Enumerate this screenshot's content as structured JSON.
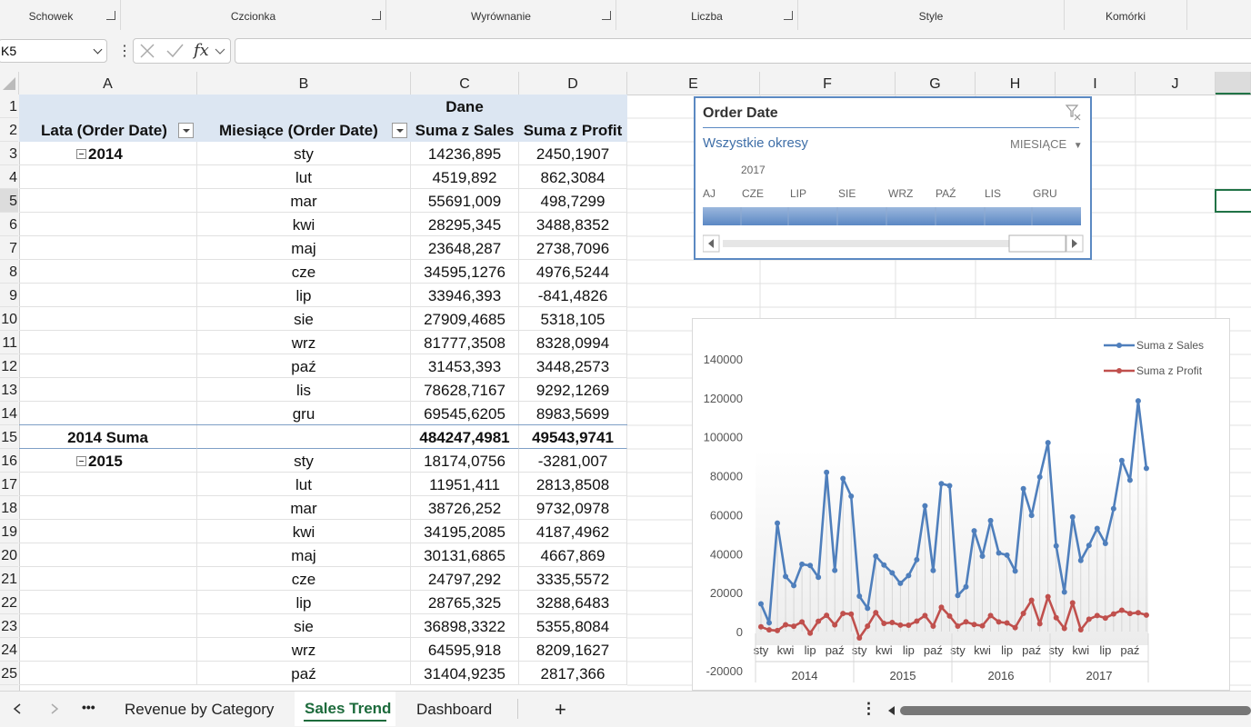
{
  "ribbon": {
    "groups": [
      {
        "label": "Schowek",
        "launcher": true
      },
      {
        "label": "Czcionka",
        "launcher": true
      },
      {
        "label": "Wyrównanie",
        "launcher": true
      },
      {
        "label": "Liczba",
        "launcher": true
      },
      {
        "label": "Style",
        "launcher": false
      },
      {
        "label": "Komórki",
        "launcher": false
      }
    ]
  },
  "formula_bar": {
    "name_box": "K5",
    "fx_label": "fx",
    "formula": ""
  },
  "columns": [
    "A",
    "B",
    "C",
    "D",
    "E",
    "F",
    "G",
    "H",
    "I",
    "J"
  ],
  "rows": [
    "1",
    "2",
    "3",
    "4",
    "5",
    "6",
    "7",
    "8",
    "9",
    "10",
    "11",
    "12",
    "13",
    "14",
    "15",
    "16",
    "17",
    "18",
    "19",
    "20",
    "21",
    "22",
    "23",
    "24",
    "25"
  ],
  "pivot": {
    "values_header": "Dane",
    "col_a_header": "Lata (Order Date)",
    "col_b_header": "Miesiące (Order Date)",
    "col_c_header": "Suma z Sales",
    "col_d_header": "Suma z Profit",
    "year_2014": "2014",
    "subtotal_2014": {
      "label": "2014 Suma",
      "sales": "484247,4981",
      "profit": "49543,9741"
    },
    "year_2015": "2015",
    "rows_2014": [
      {
        "month": "sty",
        "sales": "14236,895",
        "profit": "2450,1907"
      },
      {
        "month": "lut",
        "sales": "4519,892",
        "profit": "862,3084"
      },
      {
        "month": "mar",
        "sales": "55691,009",
        "profit": "498,7299"
      },
      {
        "month": "kwi",
        "sales": "28295,345",
        "profit": "3488,8352"
      },
      {
        "month": "maj",
        "sales": "23648,287",
        "profit": "2738,7096"
      },
      {
        "month": "cze",
        "sales": "34595,1276",
        "profit": "4976,5244"
      },
      {
        "month": "lip",
        "sales": "33946,393",
        "profit": "-841,4826"
      },
      {
        "month": "sie",
        "sales": "27909,4685",
        "profit": "5318,105"
      },
      {
        "month": "wrz",
        "sales": "81777,3508",
        "profit": "8328,0994"
      },
      {
        "month": "paź",
        "sales": "31453,393",
        "profit": "3448,2573"
      },
      {
        "month": "lis",
        "sales": "78628,7167",
        "profit": "9292,1269"
      },
      {
        "month": "gru",
        "sales": "69545,6205",
        "profit": "8983,5699"
      }
    ],
    "rows_2015": [
      {
        "month": "sty",
        "sales": "18174,0756",
        "profit": "-3281,007"
      },
      {
        "month": "lut",
        "sales": "11951,411",
        "profit": "2813,8508"
      },
      {
        "month": "mar",
        "sales": "38726,252",
        "profit": "9732,0978"
      },
      {
        "month": "kwi",
        "sales": "34195,2085",
        "profit": "4187,4962"
      },
      {
        "month": "maj",
        "sales": "30131,6865",
        "profit": "4667,869"
      },
      {
        "month": "cze",
        "sales": "24797,292",
        "profit": "3335,5572"
      },
      {
        "month": "lip",
        "sales": "28765,325",
        "profit": "3288,6483"
      },
      {
        "month": "sie",
        "sales": "36898,3322",
        "profit": "5355,8084"
      },
      {
        "month": "wrz",
        "sales": "64595,918",
        "profit": "8209,1627"
      },
      {
        "month": "paź",
        "sales": "31404,9235",
        "profit": "2817,366"
      }
    ]
  },
  "timeline": {
    "title": "Order Date",
    "period_label": "Wszystkie okresy",
    "level_label": "MIESIĄCE",
    "year_label": "2017",
    "months": [
      "AJ",
      "CZE",
      "LIP",
      "SIE",
      "WRZ",
      "PAŹ",
      "LIS",
      "GRU"
    ]
  },
  "chart_data": {
    "type": "line",
    "title": "",
    "xlabel": "",
    "ylabel": "",
    "ylim": [
      -20000,
      140000
    ],
    "yticks": [
      "140000",
      "120000",
      "100000",
      "80000",
      "60000",
      "40000",
      "20000",
      "0",
      "-20000"
    ],
    "ytick_values": [
      140000,
      120000,
      100000,
      80000,
      60000,
      40000,
      20000,
      0,
      -20000
    ],
    "x_month_labels": [
      "sty",
      "kwi",
      "lip",
      "paź"
    ],
    "x_month_label_positions": [
      1,
      4,
      7,
      10
    ],
    "years": [
      "2014",
      "2015",
      "2016",
      "2017"
    ],
    "legend_position": "top-right",
    "grid": false,
    "series": [
      {
        "name": "Suma z Sales",
        "color": "#4f7fbc",
        "values": [
          14237,
          4520,
          55691,
          28295,
          23648,
          34595,
          33946,
          27909,
          81777,
          31453,
          78629,
          69546,
          18174,
          11951,
          38726,
          34195,
          30132,
          24797,
          28765,
          36898,
          64596,
          31405,
          75973,
          74920,
          18542,
          22979,
          51716,
          38750,
          56988,
          40344,
          39262,
          31116,
          73410,
          59688,
          79412,
          96999,
          43971,
          20301,
          58872,
          36522,
          44261,
          52981,
          45264,
          63121,
          87867,
          77777,
          118448,
          83829
        ]
      },
      {
        "name": "Suma z Profit",
        "color": "#c0504d",
        "values": [
          2450,
          862,
          499,
          3489,
          2739,
          4977,
          -841,
          5318,
          8328,
          3448,
          9292,
          8984,
          -3281,
          2814,
          9732,
          4187,
          4668,
          3336,
          3289,
          5356,
          8209,
          2817,
          12474,
          8016,
          2824,
          5008,
          3611,
          2977,
          8210,
          4953,
          4432,
          2063,
          9328,
          16079,
          4046,
          17885,
          7141,
          1613,
          14751,
          934,
          6342,
          8223,
          6953,
          9040,
          10991,
          9275,
          9690,
          8484
        ]
      }
    ]
  },
  "sheet_tabs": {
    "more": "•••",
    "tabs": [
      "Revenue by Category",
      "Sales Trend",
      "Dashboard"
    ],
    "active": "Sales Trend",
    "add": "+"
  }
}
